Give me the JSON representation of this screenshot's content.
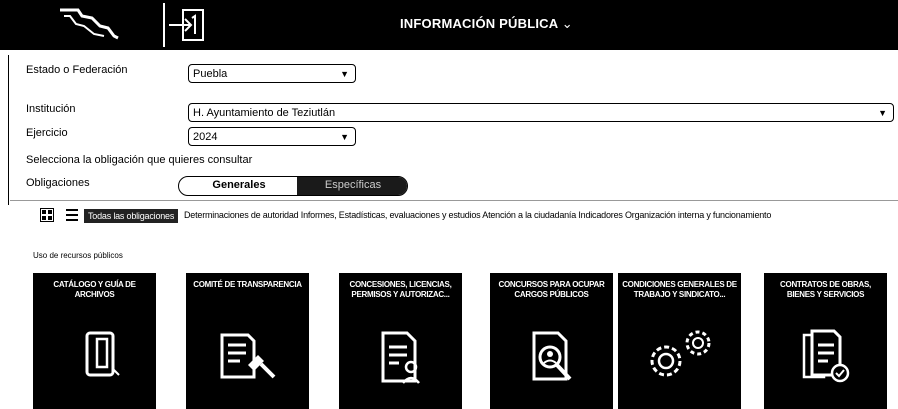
{
  "header": {
    "title": "INFORMACIÓN PÚBLICA",
    "chevron": "⌄",
    "logo_icon": "government-logo-icon",
    "login_icon": "login-icon"
  },
  "form": {
    "estado_label": "Estado o Federación",
    "estado_value": "Puebla",
    "institucion_label": "Institución",
    "institucion_value": "H. Ayuntamiento de Teziutlán",
    "ejercicio_label": "Ejercicio",
    "ejercicio_value": "2024",
    "prompt": "Selecciona la obligación que quieres consultar",
    "obligaciones_label": "Obligaciones",
    "toggle_generales": "Generales",
    "toggle_especificas": "Específicas"
  },
  "filters": {
    "active": "Todas las obligaciones",
    "rest": "Determinaciones de autoridad  Informes, Estadísticas, evaluaciones y estudios  Atención a la ciudadanía  Indicadores  Organización interna y funcionamiento"
  },
  "section_title": "Uso de recursos públicos",
  "cards": [
    {
      "title": "CATÁLOGO Y GUÍA DE ARCHIVOS",
      "icon": "archive-icon"
    },
    {
      "title": "COMITÉ DE TRANSPARENCIA",
      "icon": "gavel-document-icon"
    },
    {
      "title": "CONCESIONES, LICENCIAS, PERMISOS Y AUTORIZAC...",
      "icon": "license-document-icon"
    },
    {
      "title": "CONCURSOS PARA OCUPAR CARGOS PÚBLICOS",
      "icon": "search-person-icon"
    },
    {
      "title": "CONDICIONES GENERALES DE TRABAJO Y SINDICATO...",
      "icon": "gears-icon"
    },
    {
      "title": "CONTRATOS DE OBRAS, BIENES Y SERVICIOS",
      "icon": "contract-check-icon"
    }
  ],
  "colors": {
    "header_bg": "#000000",
    "card_bg": "#000000",
    "accent": "#ffffff"
  }
}
